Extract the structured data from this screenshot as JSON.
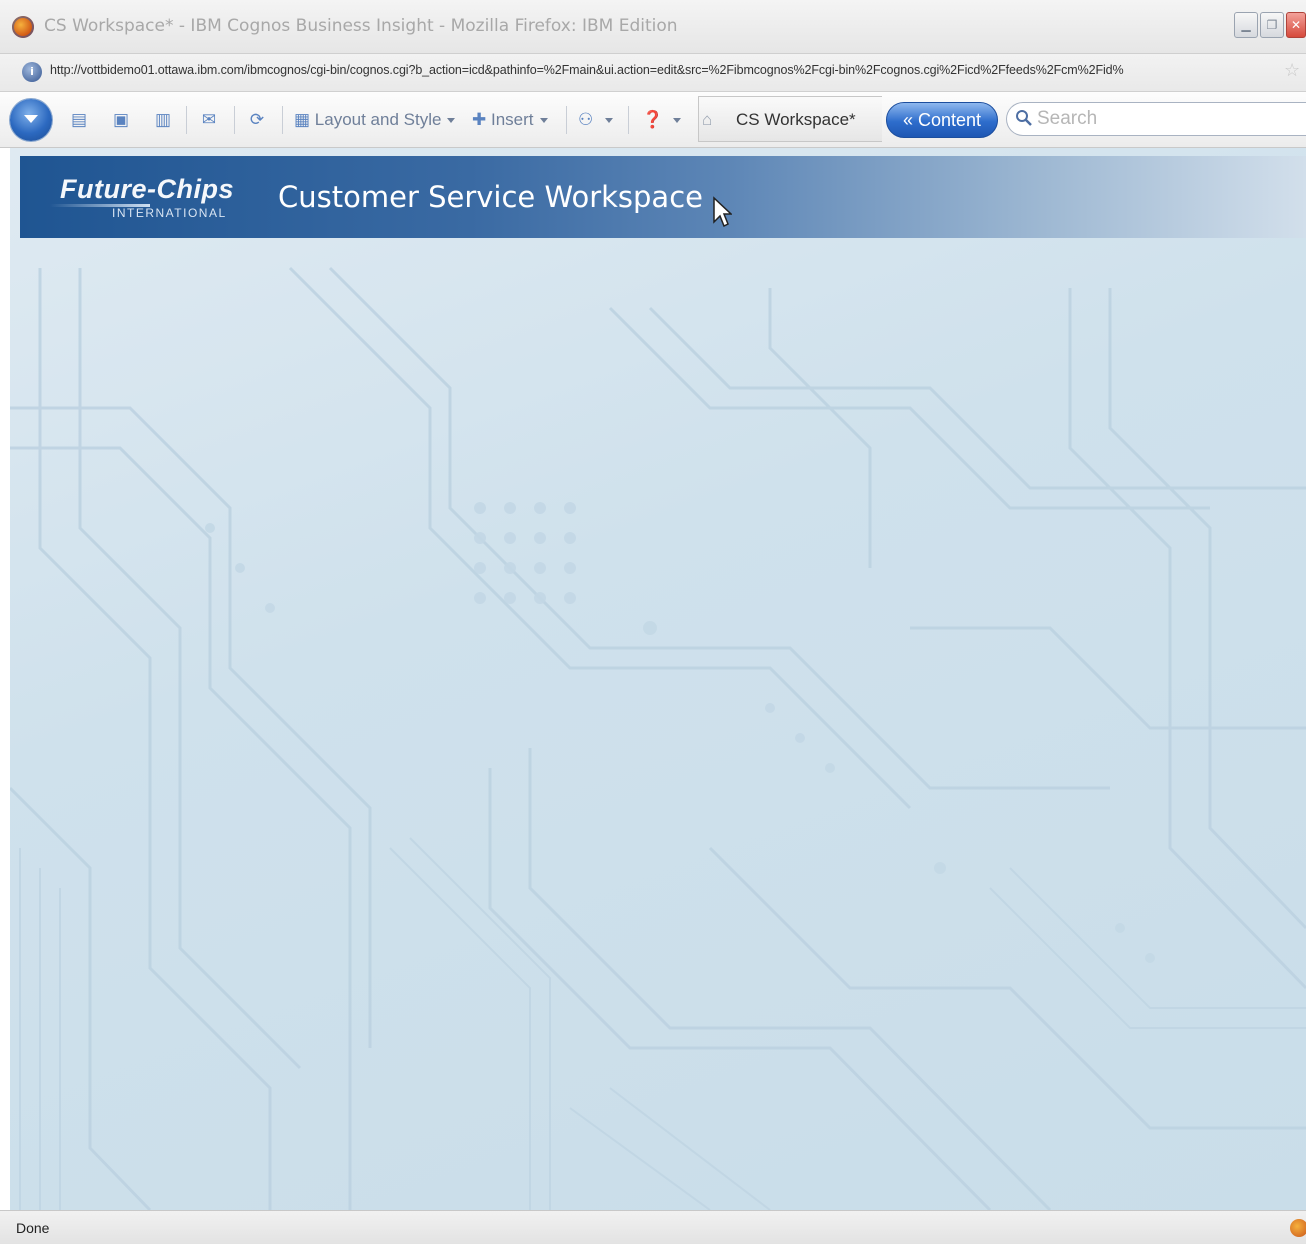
{
  "window": {
    "title": "CS Workspace* - IBM Cognos Business Insight - Mozilla Firefox: IBM Edition",
    "icons": {
      "app": "firefox-icon",
      "minimize": "minimize-icon",
      "maximize": "maximize-icon",
      "close": "close-icon"
    }
  },
  "address_bar": {
    "url": "http://vottbidemo01.ottawa.ibm.com/ibmcognos/cgi-bin/cognos.cgi?b_action=icd&pathinfo=%2Fmain&ui.action=edit&src=%2Fibmcognos%2Fcgi-bin%2Fcognos.cgi%2Ficd%2Ffeeds%2Fcm%2Fid%"
  },
  "toolbar": {
    "layout_style_label": "Layout and Style",
    "insert_label": "Insert",
    "workspace_name": "CS Workspace*",
    "content_button": "« Content",
    "search_placeholder": "Search"
  },
  "banner": {
    "logo_text": "Future-Chips",
    "logo_subtext": "INTERNATIONAL",
    "title": "Customer Service Workspace"
  },
  "status_bar": {
    "status": "Done"
  },
  "colors": {
    "banner_dark": "#1f5592",
    "workspace_bg": "#cfe1ec",
    "content_button": "#2e6dcc"
  }
}
